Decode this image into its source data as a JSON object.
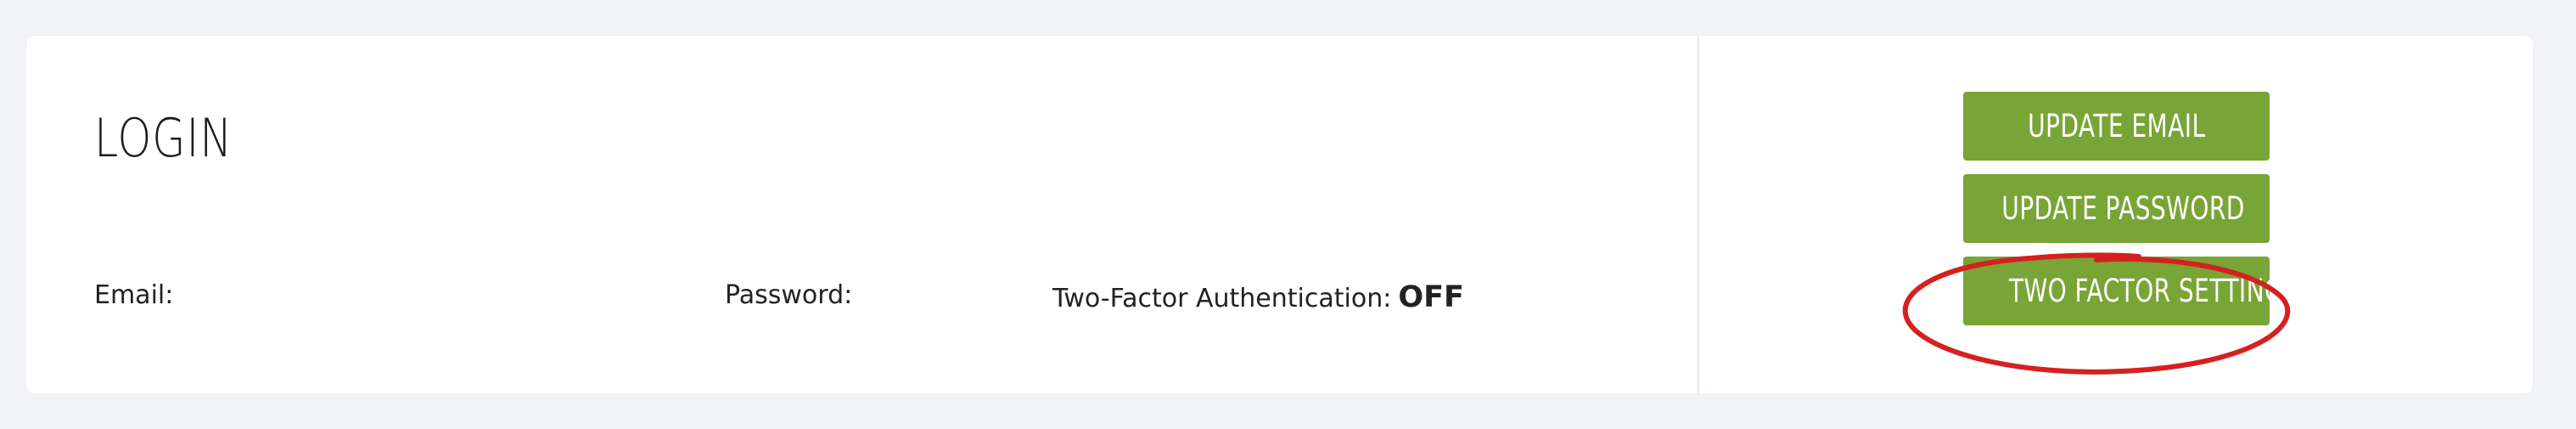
{
  "login_section": {
    "title": "LOGIN",
    "fields": {
      "email_label": "Email:",
      "password_label": "Password:",
      "two_factor_label": "Two-Factor Authentication:",
      "two_factor_value": "OFF"
    }
  },
  "actions": {
    "update_email": "UPDATE EMAIL",
    "update_password": "UPDATE PASSWORD",
    "two_factor_settings": "TWO FACTOR SETTINGS"
  },
  "colors": {
    "page_background": "#f2f3f7",
    "card_background": "#ffffff",
    "button_green": "#78a536",
    "annotation_red": "#d62020"
  }
}
